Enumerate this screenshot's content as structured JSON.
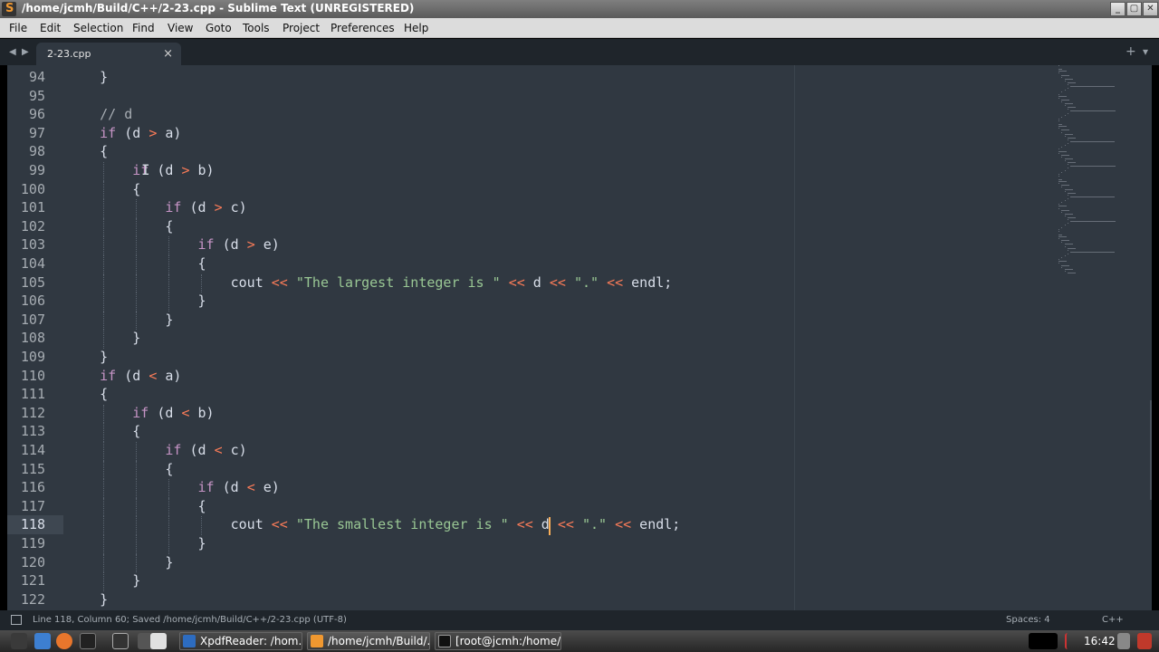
{
  "window": {
    "title": "/home/jcmh/Build/C++/2-23.cpp - Sublime Text (UNREGISTERED)",
    "minimize": "_",
    "maximize": "▢",
    "close": "✕"
  },
  "menu": [
    "File",
    "Edit",
    "Selection",
    "Find",
    "View",
    "Goto",
    "Tools",
    "Project",
    "Preferences",
    "Help"
  ],
  "tab": {
    "label": "2-23.cpp",
    "close": "×"
  },
  "tabstrip": {
    "nav_left": "◀",
    "nav_right": "▶",
    "add": "+",
    "dropdown": "▾"
  },
  "editor": {
    "current_line": 118,
    "lines": [
      {
        "n": "94",
        "code": "    }"
      },
      {
        "n": "95",
        "code": ""
      },
      {
        "n": "96",
        "code": "    // d"
      },
      {
        "n": "97",
        "code": "    if (d > a)"
      },
      {
        "n": "98",
        "code": "    {"
      },
      {
        "n": "99",
        "code": "        if (d > b)"
      },
      {
        "n": "100",
        "code": "        {"
      },
      {
        "n": "101",
        "code": "            if (d > c)"
      },
      {
        "n": "102",
        "code": "            {"
      },
      {
        "n": "103",
        "code": "                if (d > e)"
      },
      {
        "n": "104",
        "code": "                {"
      },
      {
        "n": "105",
        "code": "                    cout << \"The largest integer is \" << d << \".\" << endl;"
      },
      {
        "n": "106",
        "code": "                }"
      },
      {
        "n": "107",
        "code": "            }"
      },
      {
        "n": "108",
        "code": "        }"
      },
      {
        "n": "109",
        "code": "    }"
      },
      {
        "n": "110",
        "code": "    if (d < a)"
      },
      {
        "n": "111",
        "code": "    {"
      },
      {
        "n": "112",
        "code": "        if (d < b)"
      },
      {
        "n": "113",
        "code": "        {"
      },
      {
        "n": "114",
        "code": "            if (d < c)"
      },
      {
        "n": "115",
        "code": "            {"
      },
      {
        "n": "116",
        "code": "                if (d < e)"
      },
      {
        "n": "117",
        "code": "                {"
      },
      {
        "n": "118",
        "code": "                    cout << \"The smallest integer is \" << d << \".\" << endl;"
      },
      {
        "n": "119",
        "code": "                }"
      },
      {
        "n": "120",
        "code": "            }"
      },
      {
        "n": "121",
        "code": "        }"
      },
      {
        "n": "122",
        "code": "    }"
      }
    ]
  },
  "status": {
    "position": "Line 118, Column 60; Saved /home/jcmh/Build/C++/2-23.cpp (UTF-8)",
    "indent": "Spaces: 4",
    "syntax": "C++"
  },
  "taskbar": {
    "tasks": [
      {
        "label": "XpdfReader: /hom..."
      },
      {
        "label": "/home/jcmh/Build/..."
      },
      {
        "label": "[root@jcmh:/home/..."
      }
    ],
    "clock": "16:42"
  },
  "colors": {
    "editor_bg": "#303841",
    "keyword": "#c594c5",
    "operator": "#f97b58",
    "string": "#99c794",
    "caret": "#f9ae58"
  }
}
